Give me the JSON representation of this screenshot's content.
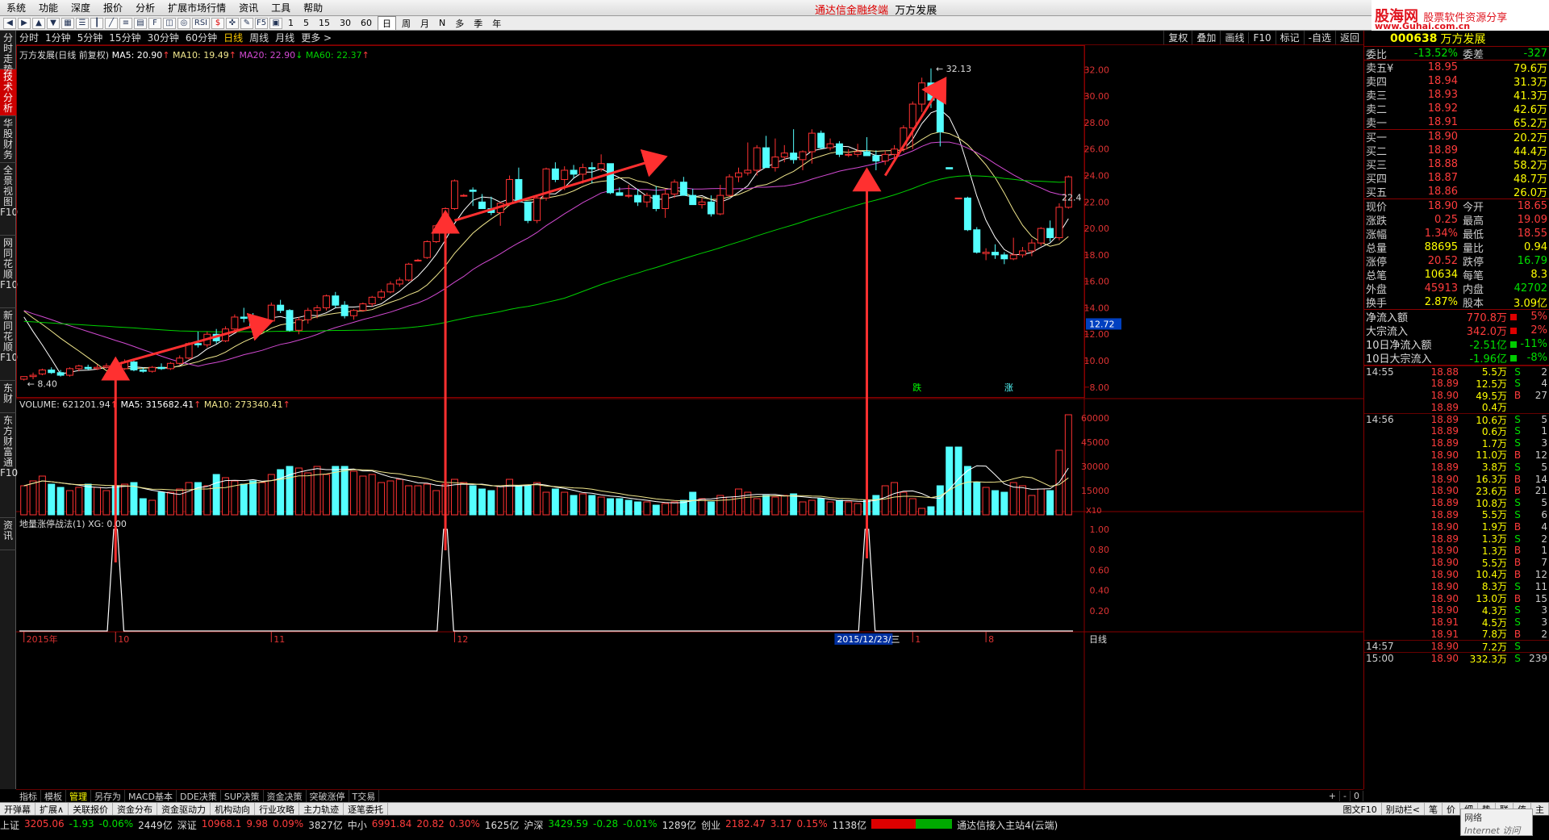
{
  "menu": {
    "items": [
      "系统",
      "功能",
      "深度",
      "报价",
      "分析",
      "扩展市场行情",
      "资讯",
      "工具",
      "帮助"
    ],
    "title": "通达信金融终端",
    "stock_name": "万方发展"
  },
  "logo": {
    "site": "股海网",
    "tag": "股票软件资源分享",
    "url": "www.Guhai.com.cn"
  },
  "toolbar": {
    "periods_small": [
      "1",
      "5",
      "15",
      "30",
      "60"
    ],
    "periods_big": [
      "日",
      "周",
      "月",
      "N",
      "多",
      "季",
      "年"
    ]
  },
  "leftnav": [
    "分时走势",
    "技术分析",
    "华股财务",
    "全景视图F10",
    "网同花顺F10",
    "新同花顺F10",
    "东财",
    "东方财富通F10",
    "资讯"
  ],
  "periods": [
    "分时",
    "1分钟",
    "5分钟",
    "15分钟",
    "30分钟",
    "60分钟",
    "日线",
    "周线",
    "月线",
    "更多 >"
  ],
  "right_buttons": [
    "复权",
    "叠加",
    "画线",
    "F10",
    "标记",
    "-自选",
    "返回"
  ],
  "main_legend": {
    "name": "万方发展(日线 前复权)",
    "ma5": "MA5: 20.90",
    "ma10": "MA10: 19.49",
    "ma20": "MA20: 22.90",
    "ma60": "MA60: 22.37"
  },
  "vol_legend": {
    "vol": "VOLUME: 621201.94",
    "ma5": "MA5: 315682.41",
    "ma10": "MA10: 273340.41"
  },
  "ind_legend": "地量涨停战法(1) XG: 0.00",
  "price_axis": [
    "32.00",
    "30.00",
    "28.00",
    "26.00",
    "24.00",
    "22.00",
    "20.00",
    "18.00",
    "16.00",
    "14.00",
    "12.00",
    "10.00",
    "8.00"
  ],
  "price_marker": "12.72",
  "vol_axis": [
    "60000",
    "45000",
    "30000",
    "15000"
  ],
  "vol_unit": "X10",
  "ind_axis": [
    "1.00",
    "0.80",
    "0.60",
    "0.40",
    "0.20"
  ],
  "annotations": {
    "high": "32.13",
    "low": "8.40",
    "right": "22.4",
    "fall": "跌",
    "rise": "涨"
  },
  "date_axis": {
    "year": "2015年",
    "m10": "10",
    "m11": "11",
    "m12": "12",
    "cursor": "2015/12/23/三",
    "m1": "1",
    "m8": "8",
    "period": "日线"
  },
  "chart_data": {
    "type": "candlestick",
    "ylim": [
      7.5,
      33
    ],
    "candles": [
      [
        8.6,
        8.8,
        8.5,
        8.8
      ],
      [
        8.8,
        9.1,
        8.6,
        8.9
      ],
      [
        9.0,
        9.4,
        8.9,
        9.3
      ],
      [
        9.3,
        9.5,
        9.0,
        9.1
      ],
      [
        9.1,
        9.3,
        8.8,
        8.9
      ],
      [
        8.9,
        9.5,
        8.8,
        9.4
      ],
      [
        9.4,
        9.7,
        9.2,
        9.6
      ],
      [
        9.5,
        9.7,
        9.3,
        9.4
      ],
      [
        9.4,
        9.7,
        9.3,
        9.5
      ],
      [
        9.5,
        9.8,
        9.4,
        9.6
      ],
      [
        9.6,
        9.9,
        9.3,
        9.4
      ],
      [
        9.4,
        10.1,
        9.3,
        9.9
      ],
      [
        9.9,
        10.0,
        9.2,
        9.3
      ],
      [
        9.3,
        9.5,
        9.1,
        9.2
      ],
      [
        9.2,
        9.6,
        9.1,
        9.5
      ],
      [
        9.5,
        9.8,
        9.3,
        9.4
      ],
      [
        9.4,
        9.9,
        9.3,
        9.8
      ],
      [
        9.8,
        10.4,
        9.7,
        10.2
      ],
      [
        10.2,
        11.4,
        10.1,
        11.3
      ],
      [
        11.3,
        12.2,
        11.0,
        11.2
      ],
      [
        11.2,
        12.2,
        11.0,
        12.0
      ],
      [
        12.0,
        12.4,
        11.3,
        11.5
      ],
      [
        11.5,
        12.6,
        11.4,
        12.4
      ],
      [
        12.4,
        13.5,
        12.2,
        13.3
      ],
      [
        13.3,
        14.0,
        12.9,
        13.2
      ],
      [
        13.2,
        13.6,
        12.3,
        12.5
      ],
      [
        12.5,
        13.2,
        12.3,
        13.0
      ],
      [
        13.0,
        14.4,
        12.9,
        14.2
      ],
      [
        14.2,
        14.6,
        13.6,
        13.8
      ],
      [
        13.8,
        13.9,
        12.2,
        12.3
      ],
      [
        12.3,
        13.3,
        12.0,
        13.1
      ],
      [
        13.1,
        14.0,
        12.8,
        13.8
      ],
      [
        13.8,
        14.2,
        13.2,
        14.0
      ],
      [
        14.0,
        15.0,
        13.8,
        14.9
      ],
      [
        14.9,
        15.2,
        14.0,
        14.2
      ],
      [
        14.2,
        14.5,
        13.2,
        13.4
      ],
      [
        13.4,
        13.9,
        13.1,
        13.8
      ],
      [
        13.8,
        14.4,
        13.7,
        14.3
      ],
      [
        14.3,
        14.9,
        14.1,
        14.8
      ],
      [
        14.8,
        15.4,
        14.6,
        15.2
      ],
      [
        15.2,
        16.0,
        15.1,
        15.8
      ],
      [
        15.8,
        16.3,
        15.6,
        16.1
      ],
      [
        16.1,
        17.4,
        16.0,
        17.3
      ],
      [
        17.6,
        17.7,
        17.5,
        17.6
      ],
      [
        17.8,
        19.1,
        17.7,
        19.0
      ],
      [
        19.0,
        20.3,
        18.9,
        20.2
      ],
      [
        20.2,
        21.6,
        20.1,
        21.5
      ],
      [
        21.5,
        23.7,
        21.4,
        23.6
      ],
      [
        22.5,
        22.6,
        22.4,
        22.5
      ],
      [
        22.9,
        23.1,
        21.7,
        22.8
      ],
      [
        22.0,
        22.6,
        21.6,
        21.5
      ],
      [
        21.5,
        22.4,
        21.0,
        21.2
      ],
      [
        21.2,
        22.0,
        20.2,
        21.9
      ],
      [
        21.9,
        24.0,
        21.7,
        23.7
      ],
      [
        23.7,
        24.6,
        23.2,
        22.0
      ],
      [
        22.0,
        21.3,
        20.4,
        20.6
      ],
      [
        20.6,
        22.5,
        20.4,
        22.3
      ],
      [
        22.3,
        24.6,
        22.1,
        24.5
      ],
      [
        24.5,
        25.0,
        23.5,
        23.7
      ],
      [
        23.7,
        24.7,
        22.9,
        24.4
      ],
      [
        24.4,
        24.8,
        23.8,
        24.1
      ],
      [
        24.1,
        24.9,
        23.4,
        24.6
      ],
      [
        24.6,
        25.0,
        23.4,
        24.5
      ],
      [
        24.5,
        25.6,
        24.3,
        24.9
      ],
      [
        24.9,
        24.6,
        22.6,
        22.7
      ],
      [
        22.7,
        23.1,
        22.5,
        22.5
      ],
      [
        22.5,
        23.3,
        22.3,
        22.5
      ],
      [
        22.5,
        23.0,
        21.7,
        22.0
      ],
      [
        22.0,
        22.7,
        21.6,
        22.5
      ],
      [
        22.5,
        23.2,
        21.3,
        21.5
      ],
      [
        21.5,
        23.0,
        20.8,
        22.6
      ],
      [
        22.6,
        23.7,
        22.3,
        23.5
      ],
      [
        23.5,
        23.9,
        22.9,
        22.5
      ],
      [
        22.5,
        23.0,
        21.9,
        21.8
      ],
      [
        21.8,
        22.3,
        21.5,
        22.0
      ],
      [
        22.0,
        22.5,
        20.9,
        21.1
      ],
      [
        21.1,
        23.3,
        21.0,
        22.5
      ],
      [
        22.5,
        24.1,
        22.4,
        23.9
      ],
      [
        23.9,
        24.6,
        23.5,
        24.2
      ],
      [
        24.2,
        26.5,
        24.0,
        24.4
      ],
      [
        24.4,
        26.3,
        24.0,
        26.1
      ],
      [
        26.1,
        27.0,
        25.9,
        24.6
      ],
      [
        24.6,
        26.8,
        24.3,
        25.4
      ],
      [
        25.4,
        26.3,
        25.0,
        25.7
      ],
      [
        25.7,
        27.5,
        24.9,
        25.2
      ],
      [
        25.2,
        25.9,
        24.4,
        25.8
      ],
      [
        25.8,
        27.5,
        24.9,
        27.2
      ],
      [
        27.2,
        27.4,
        26.0,
        26.1
      ],
      [
        26.1,
        26.8,
        25.9,
        26.4
      ],
      [
        26.4,
        26.6,
        25.4,
        25.6
      ],
      [
        25.6,
        26.0,
        25.4,
        25.6
      ],
      [
        25.6,
        26.4,
        25.4,
        25.8
      ],
      [
        25.8,
        26.9,
        25.5,
        25.5
      ],
      [
        25.5,
        25.9,
        24.4,
        25.1
      ],
      [
        25.1,
        25.9,
        24.8,
        25.6
      ],
      [
        25.6,
        26.3,
        25.1,
        26.0
      ],
      [
        26.0,
        27.8,
        25.8,
        27.6
      ],
      [
        27.6,
        29.6,
        26.0,
        29.4
      ],
      [
        29.4,
        31.4,
        28.8,
        31.0
      ],
      [
        31.0,
        32.1,
        29.1,
        29.7
      ],
      [
        30.2,
        30.6,
        26.2,
        27.3
      ],
      [
        24.6,
        24.6,
        24.5,
        24.5
      ],
      [
        22.3,
        22.3,
        22.2,
        22.3
      ],
      [
        22.3,
        22.4,
        19.8,
        19.9
      ],
      [
        19.9,
        20.1,
        18.1,
        18.2
      ],
      [
        18.1,
        18.5,
        17.6,
        18.2
      ],
      [
        18.2,
        18.8,
        17.7,
        18.0
      ],
      [
        18.0,
        18.2,
        17.3,
        17.7
      ],
      [
        17.7,
        19.3,
        17.6,
        18.0
      ],
      [
        18.0,
        18.6,
        17.8,
        18.3
      ],
      [
        18.3,
        19.2,
        17.9,
        18.9
      ],
      [
        18.9,
        20.1,
        18.7,
        20.0
      ],
      [
        20.0,
        20.6,
        19.0,
        19.3
      ],
      [
        19.3,
        21.9,
        19.1,
        21.6
      ],
      [
        21.6,
        24.0,
        21.5,
        23.9
      ]
    ],
    "volumes": [
      18000,
      21000,
      24000,
      19000,
      17000,
      15000,
      17000,
      19000,
      17000,
      15000,
      18000,
      19000,
      20000,
      10000,
      9000,
      14000,
      14000,
      16000,
      20000,
      20000,
      18000,
      25000,
      23000,
      21000,
      19000,
      21000,
      20000,
      25000,
      28000,
      30000,
      29000,
      26000,
      30000,
      25000,
      30000,
      30000,
      27000,
      24000,
      25000,
      20000,
      21000,
      22000,
      18000,
      18000,
      19000,
      15000,
      19000,
      22000,
      20000,
      18000,
      16000,
      15000,
      18000,
      22000,
      18000,
      18000,
      20000,
      14000,
      16000,
      14000,
      12000,
      13000,
      12000,
      11000,
      10000,
      10000,
      9000,
      8000,
      8000,
      6000,
      7000,
      8000,
      9000,
      14000,
      10000,
      8000,
      12000,
      11000,
      16000,
      14000,
      10000,
      12000,
      11000,
      12000,
      13000,
      8000,
      9000,
      10000,
      8000,
      9000,
      8000,
      7000,
      9000,
      12000,
      18000,
      20000,
      14000,
      10000,
      4000,
      5000,
      18000,
      42000,
      42000,
      30000,
      20000,
      17000,
      15000,
      14000,
      20000,
      18000,
      12000,
      16000,
      15000,
      40000,
      62000
    ],
    "volume_up": [
      1,
      1,
      1,
      0,
      0,
      1,
      1,
      0,
      1,
      1,
      0,
      1,
      0,
      0,
      1,
      0,
      1,
      1,
      1,
      0,
      1,
      0,
      1,
      1,
      0,
      0,
      1,
      1,
      0,
      0,
      1,
      1,
      1,
      1,
      0,
      0,
      1,
      1,
      1,
      1,
      1,
      1,
      1,
      1,
      1,
      1,
      1,
      1,
      1,
      0,
      0,
      0,
      1,
      1,
      0,
      0,
      1,
      1,
      0,
      1,
      0,
      1,
      0,
      1,
      0,
      0,
      0,
      0,
      1,
      0,
      1,
      1,
      0,
      0,
      1,
      0,
      1,
      1,
      1,
      1,
      1,
      0,
      1,
      1,
      0,
      1,
      1,
      0,
      1,
      0,
      1,
      1,
      0,
      0,
      1,
      1,
      1,
      1,
      1,
      0,
      0,
      0,
      0,
      0,
      0,
      1,
      0,
      0,
      1,
      1,
      1,
      1,
      0,
      1,
      1
    ],
    "signal_days": [
      10,
      46,
      92
    ],
    "series": [
      {
        "name": "MA5",
        "color": "#ffffff"
      },
      {
        "name": "MA10",
        "color": "#f0e68c"
      },
      {
        "name": "MA20",
        "color": "#d24ad2"
      },
      {
        "name": "MA60",
        "color": "#00d000"
      }
    ]
  },
  "quote": {
    "code": "000638",
    "name": "万方发展",
    "weibi_label": "委比",
    "weibi": "-13.52%",
    "weicha_label": "委差",
    "weicha": "-327",
    "asks": [
      {
        "l": "卖五¥",
        "p": "18.95",
        "v": "79.6万"
      },
      {
        "l": "卖四",
        "p": "18.94",
        "v": "31.3万"
      },
      {
        "l": "卖三",
        "p": "18.93",
        "v": "41.3万"
      },
      {
        "l": "卖二",
        "p": "18.92",
        "v": "42.6万"
      },
      {
        "l": "卖一",
        "p": "18.91",
        "v": "65.2万"
      }
    ],
    "bids": [
      {
        "l": "买一",
        "p": "18.90",
        "v": "20.2万"
      },
      {
        "l": "买二",
        "p": "18.89",
        "v": "44.4万"
      },
      {
        "l": "买三",
        "p": "18.88",
        "v": "58.2万"
      },
      {
        "l": "买四",
        "p": "18.87",
        "v": "48.7万"
      },
      {
        "l": "买五",
        "p": "18.86",
        "v": "26.0万"
      }
    ],
    "stats": [
      [
        "现价",
        "18.90",
        "今开",
        "18.65"
      ],
      [
        "涨跌",
        "0.25",
        "最高",
        "19.09"
      ],
      [
        "涨幅",
        "1.34%",
        "最低",
        "18.55"
      ],
      [
        "总量",
        "88695",
        "量比",
        "0.94"
      ],
      [
        "涨停",
        "20.52",
        "跌停",
        "16.79"
      ],
      [
        "总笔",
        "10634",
        "每笔",
        "8.3"
      ],
      [
        "外盘",
        "45913",
        "内盘",
        "42702"
      ],
      [
        "换手",
        "2.87%",
        "股本",
        "3.09亿"
      ]
    ],
    "flows": [
      [
        "净流入额",
        "770.8万",
        "5%"
      ],
      [
        "大宗流入",
        "342.0万",
        "2%"
      ],
      [
        "10日净流入额",
        "-2.51亿",
        "-11%"
      ],
      [
        "10日大宗流入",
        "-1.96亿",
        "-8%"
      ]
    ]
  },
  "ticks": [
    [
      "14:55",
      "18.88",
      "5.5万",
      "S",
      "2"
    ],
    [
      "",
      "18.89",
      "12.5万",
      "S",
      "4"
    ],
    [
      "",
      "18.90",
      "49.5万",
      "B",
      "27"
    ],
    [
      "",
      "18.89",
      "0.4万",
      "",
      ""
    ],
    [
      "14:56",
      "18.89",
      "10.6万",
      "S",
      "5"
    ],
    [
      "",
      "18.89",
      "0.6万",
      "S",
      "1"
    ],
    [
      "",
      "18.89",
      "1.7万",
      "S",
      "3"
    ],
    [
      "",
      "18.90",
      "11.0万",
      "B",
      "12"
    ],
    [
      "",
      "18.89",
      "3.8万",
      "S",
      "5"
    ],
    [
      "",
      "18.90",
      "16.3万",
      "B",
      "14"
    ],
    [
      "",
      "18.90",
      "23.6万",
      "B",
      "21"
    ],
    [
      "",
      "18.89",
      "10.8万",
      "S",
      "5"
    ],
    [
      "",
      "18.89",
      "5.5万",
      "S",
      "6"
    ],
    [
      "",
      "18.90",
      "1.9万",
      "B",
      "4"
    ],
    [
      "",
      "18.89",
      "1.3万",
      "S",
      "2"
    ],
    [
      "",
      "18.90",
      "1.3万",
      "B",
      "1"
    ],
    [
      "",
      "18.90",
      "5.5万",
      "B",
      "7"
    ],
    [
      "",
      "18.90",
      "10.4万",
      "B",
      "12"
    ],
    [
      "",
      "18.90",
      "8.3万",
      "S",
      "11"
    ],
    [
      "",
      "18.90",
      "13.0万",
      "B",
      "15"
    ],
    [
      "",
      "18.90",
      "4.3万",
      "S",
      "3"
    ],
    [
      "",
      "18.91",
      "4.5万",
      "S",
      "3"
    ],
    [
      "",
      "18.91",
      "7.8万",
      "B",
      "2"
    ],
    [
      "14:57",
      "18.90",
      "7.2万",
      "S",
      ""
    ],
    [
      "15:00",
      "18.90",
      "332.3万",
      "S",
      "239"
    ]
  ],
  "bottom_tabs": [
    "指标",
    "模板",
    "管理",
    "另存为",
    "MACD基本",
    "DDE决策",
    "SUP决策",
    "资金决策",
    "突破涨停",
    "T交易"
  ],
  "tabs2": [
    "开弹幕",
    "扩展∧",
    "关联报价",
    "资金分布",
    "资金驱动力",
    "机构动向",
    "行业攻略",
    "主力轨迹",
    "逐笔委托"
  ],
  "tabs2_right": [
    "图文F10",
    "别动栏<",
    "笔",
    "价",
    "细",
    "势",
    "联",
    "值",
    "主"
  ],
  "status": {
    "sh_label": "上证",
    "sh": "3205.06",
    "sh_chg": "-1.93",
    "sh_pct": "-0.06%",
    "sh_amt": "2449亿",
    "sz_label": "深证",
    "sz": "10968.1",
    "sz_chg": "9.98",
    "sz_pct": "0.09%",
    "sz_amt": "3827亿",
    "zx_label": "中小",
    "zx": "6991.84",
    "zx_chg": "20.82",
    "zx_pct": "0.30%",
    "zx_amt": "1625亿",
    "hs_label": "沪深",
    "hs": "3429.59",
    "hs_chg": "-0.28",
    "hs_pct": "-0.01%",
    "hs_amt": "1289亿",
    "cy_label": "创业",
    "cy": "2182.47",
    "cy_chg": "3.17",
    "cy_pct": "0.15%",
    "cy_amt": "1138亿",
    "server": "通达信接入主站4(云端)"
  },
  "netbox": {
    "l1": "网络",
    "l2": "Internet 访问"
  }
}
